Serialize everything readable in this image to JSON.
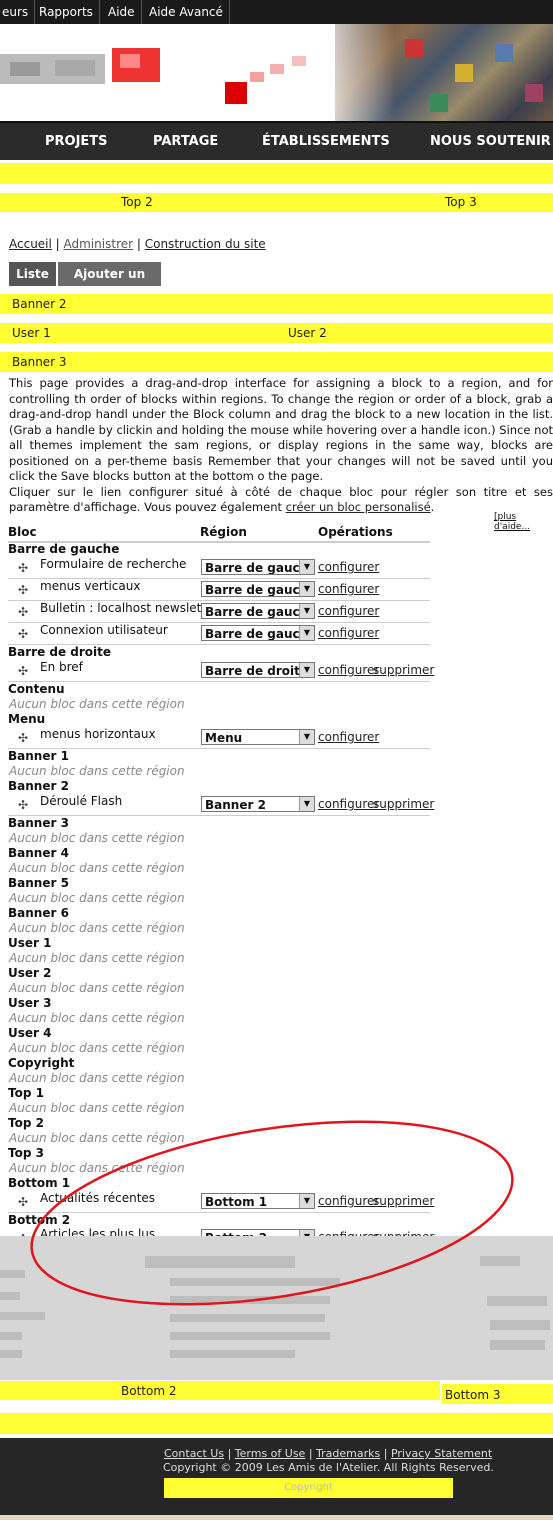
{
  "admin_bar": {
    "items": [
      "eurs",
      "Rapports",
      "Aide",
      "Aide Avancé"
    ]
  },
  "nav": {
    "items": [
      "PROJETS",
      "PARTAGE",
      "ÉTABLISSEMENTS",
      "NOUS SOUTENIR"
    ]
  },
  "regions_top": {
    "top2": "Top 2",
    "top3": "Top 3"
  },
  "breadcrumb": {
    "home": "Accueil",
    "admin": "Administrer",
    "site": "Construction du site"
  },
  "tabs": {
    "list": "Liste",
    "add": "Ajouter un bloc"
  },
  "region_labels": {
    "banner2": "Banner 2",
    "user1": "User 1",
    "user2": "User 2",
    "banner3": "Banner 3"
  },
  "help": {
    "p1": "This page provides a drag-and-drop interface for assigning a block to a region, and for controlling th order of blocks within regions. To change the region or order of a block, grab a drag-and-drop handl under the Block column and drag the block to a new location in the list. (Grab a handle by clickin and holding the mouse while hovering over a handle icon.) Since not all themes implement the sam regions, or display regions in the same way, blocks are positioned on a per-theme basis Remember that your changes will not be saved until you click the Save blocks button at the bottom o the page.",
    "p2_a": "Cliquer sur le lien configurer situé à côté de chaque bloc pour régler son titre et ses paramètre d'affichage. Vous pouvez également ",
    "p2_link": "créer un bloc personalisé",
    "p2_end": ".",
    "more": "[plus d'aide..."
  },
  "table": {
    "headers": {
      "block": "Bloc",
      "region": "Région",
      "ops": "Opérations"
    },
    "empty_text": "Aucun bloc dans cette région",
    "configure": "configurer",
    "delete": "supprimer",
    "regions": {
      "left": "Barre de gauche",
      "right": "Barre de droite",
      "content": "Contenu",
      "menu": "Menu",
      "banner1": "Banner 1",
      "banner2": "Banner 2",
      "banner3": "Banner 3",
      "banner4": "Banner 4",
      "banner5": "Banner 5",
      "banner6": "Banner 6",
      "user1": "User 1",
      "user2": "User 2",
      "user3": "User 3",
      "user4": "User 4",
      "copyright": "Copyright",
      "top1": "Top 1",
      "top2": "Top 2",
      "top3": "Top 3",
      "bottom1": "Bottom 1",
      "bottom2": "Bottom 2"
    },
    "blocks": {
      "search": {
        "name": "Formulaire de recherche",
        "region": "Barre de gauche"
      },
      "vmenus": {
        "name": "menus verticaux",
        "region": "Barre de gauche"
      },
      "news": {
        "name": "Bulletin : localhost newsletter",
        "region": "Barre de gauche"
      },
      "login": {
        "name": "Connexion utilisateur",
        "region": "Barre de gauche"
      },
      "brief": {
        "name": "En bref",
        "region": "Barre de droite"
      },
      "hmenus": {
        "name": "menus horizontaux",
        "region": "Menu"
      },
      "flash": {
        "name": "Déroulé Flash",
        "region": "Banner 2"
      },
      "recent": {
        "name": "Actualités récentes",
        "region": "Bottom 1"
      },
      "popular": {
        "name": "Articles les plus lus",
        "region": "Bottom 2"
      }
    }
  },
  "regions_bottom": {
    "bottom2": "Bottom 2",
    "bottom3": "Bottom 3"
  },
  "footer": {
    "links": [
      "Contact Us",
      "Terms of Use",
      "Trademarks",
      "Privacy Statement"
    ],
    "copyright": "Copyright © 2009 Les Amis de l'Atelier. All Rights Reserved.",
    "region": "Copyright"
  },
  "colors": {
    "region_highlight": "#ffff33",
    "nav_bg": "#2b2b2b",
    "annotation": "#e0161b"
  }
}
